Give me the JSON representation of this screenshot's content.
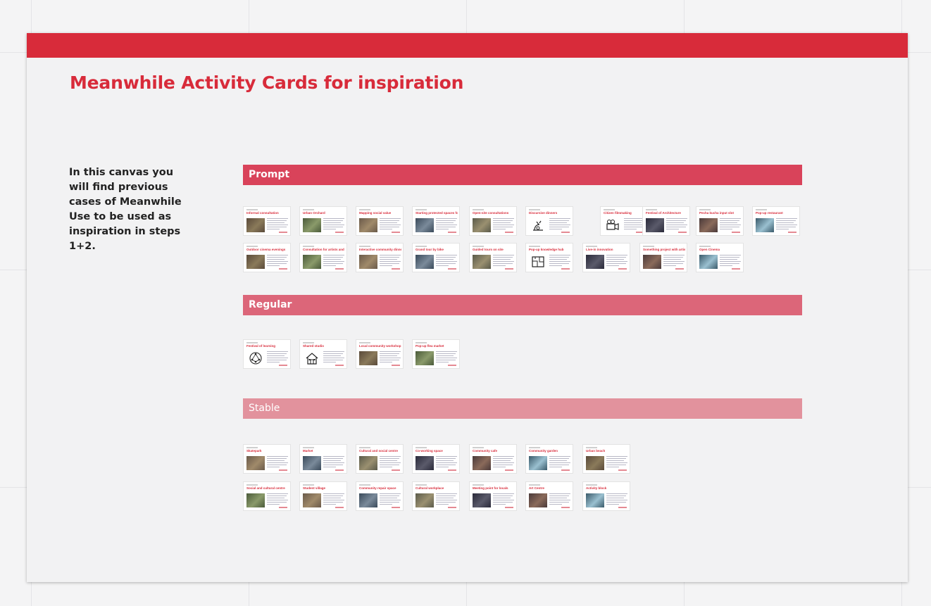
{
  "colors": {
    "brand_red": "#d82b3a",
    "prompt_bar": "#d9435a",
    "regular_bar": "#dc6679",
    "stable_bar": "#e2929d"
  },
  "board": {
    "title": "Meanwhile Activity Cards for inspiration",
    "intro": "In this canvas you will find previous cases of Meanwhile Use to be used as inspiration in steps 1+2."
  },
  "sections": {
    "prompt": "Prompt",
    "regular": "Regular",
    "stable": "Stable"
  },
  "cards": {
    "prompt_row1": [
      {
        "title": "Informal consultation",
        "img": "photo"
      },
      {
        "title": "Urban Orchard",
        "img": "photo"
      },
      {
        "title": "Mapping social value",
        "img": "photo"
      },
      {
        "title": "Starting protected spaces for connection and community",
        "img": "photo"
      },
      {
        "title": "Open-site consultations",
        "img": "photo"
      },
      {
        "title": "Discursive dinners",
        "img": "dinner-icon"
      },
      {
        "title": "Citizen filmmaking",
        "img": "camera-icon"
      },
      {
        "title": "Festival of Architecture",
        "img": "photo"
      },
      {
        "title": "Pecha kucha input slot",
        "img": "photo"
      },
      {
        "title": "Pop-up restaurant",
        "img": "photo"
      }
    ],
    "prompt_row2": [
      {
        "title": "Outdoor cinema evenings",
        "img": "photo"
      },
      {
        "title": "Consultation for artists and families",
        "img": "photo"
      },
      {
        "title": "Interactive community dinner",
        "img": "photo"
      },
      {
        "title": "Grand tour by bike",
        "img": "photo"
      },
      {
        "title": "Guided tours on site",
        "img": "photo"
      },
      {
        "title": "Pop-up knowledge hub",
        "img": "plan-icon"
      },
      {
        "title": "Live-in innovation",
        "img": "photo"
      },
      {
        "title": "Something project with artists",
        "img": "photo"
      },
      {
        "title": "Open Cinema",
        "img": "photo"
      }
    ],
    "regular": [
      {
        "title": "Festival of learning",
        "img": "network-icon"
      },
      {
        "title": "Shared studio",
        "img": "house-icon"
      },
      {
        "title": "Local community workshop",
        "img": "photo"
      },
      {
        "title": "Pop-up flea market",
        "img": "photo"
      }
    ],
    "stable_row1": [
      {
        "title": "Skatepark",
        "img": "photo"
      },
      {
        "title": "Market",
        "img": "photo"
      },
      {
        "title": "Cultural and social centre",
        "img": "photo"
      },
      {
        "title": "Co-working space",
        "img": "photo"
      },
      {
        "title": "Community cafe",
        "img": "photo"
      },
      {
        "title": "Community garden",
        "img": "photo"
      },
      {
        "title": "Urban beach",
        "img": "photo"
      }
    ],
    "stable_row2": [
      {
        "title": "Social and cultural centre",
        "img": "photo"
      },
      {
        "title": "Student village",
        "img": "photo"
      },
      {
        "title": "Community repair space",
        "img": "photo"
      },
      {
        "title": "Cultural workplace",
        "img": "photo"
      },
      {
        "title": "Meeting point for locals",
        "img": "photo"
      },
      {
        "title": "Art Centre",
        "img": "photo"
      },
      {
        "title": "Activity block",
        "img": "photo"
      }
    ]
  }
}
